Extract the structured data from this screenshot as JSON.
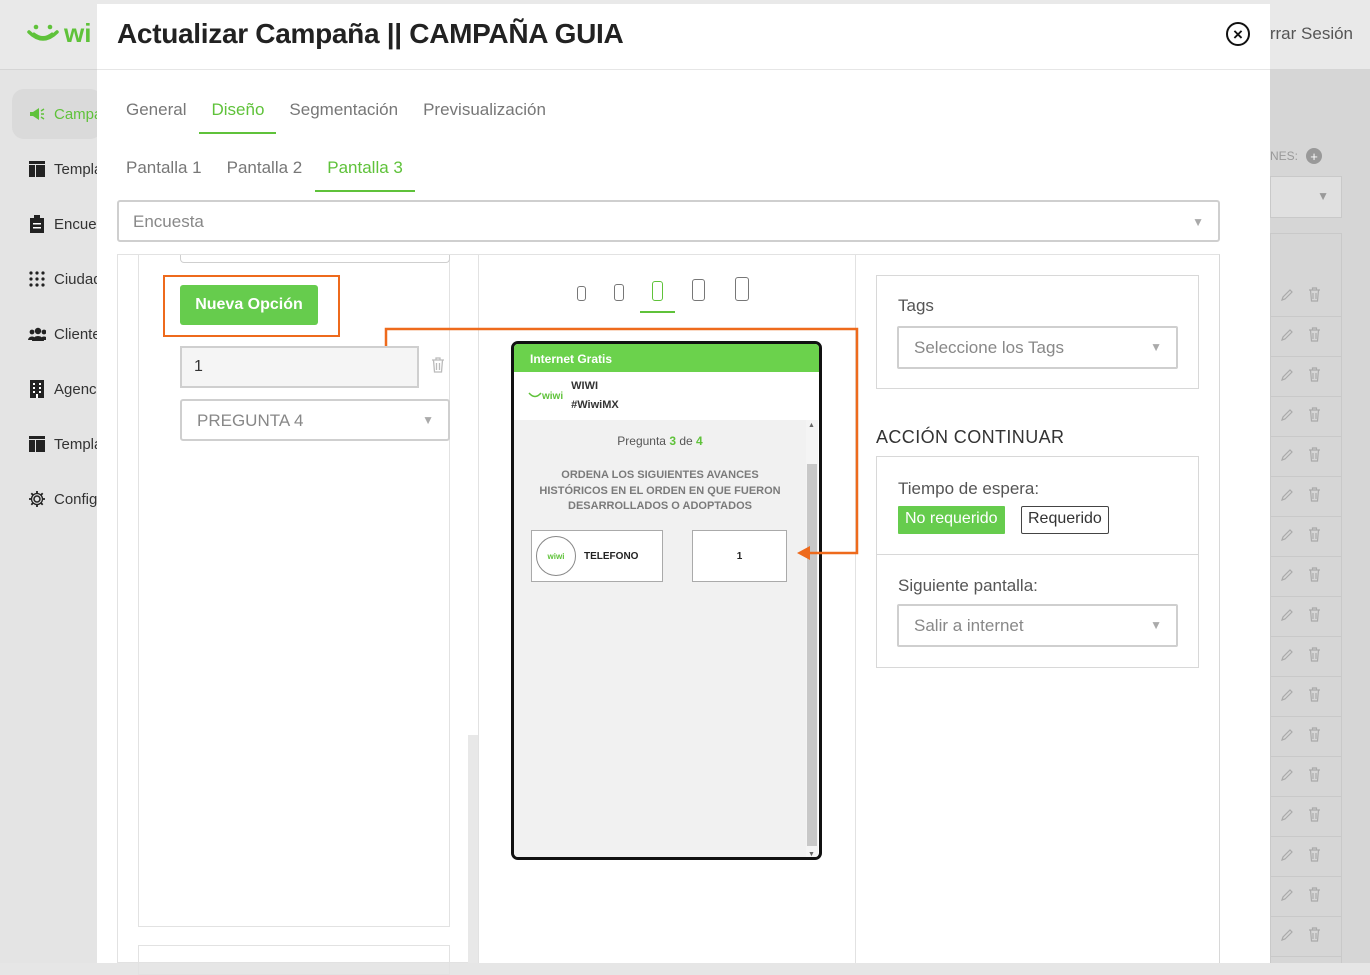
{
  "app": {
    "logo_text": "wi",
    "logout_label": "rrar Sesión"
  },
  "sidebar": {
    "items": [
      {
        "label": "Campa",
        "icon": "megaphone-icon"
      },
      {
        "label": "Templa",
        "icon": "template-icon"
      },
      {
        "label": "Encues",
        "icon": "clipboard-icon"
      },
      {
        "label": "Ciudad",
        "icon": "grid-dots-icon"
      },
      {
        "label": "Cliente",
        "icon": "users-icon"
      },
      {
        "label": "Agenci",
        "icon": "building-icon"
      },
      {
        "label": "Templa",
        "icon": "template-icon"
      },
      {
        "label": "Config",
        "icon": "gear-icon"
      }
    ]
  },
  "background_table": {
    "header_label": "NES:"
  },
  "modal": {
    "title": "Actualizar Campaña || CAMPAÑA GUIA",
    "tabs": [
      "General",
      "Diseño",
      "Segmentación",
      "Previsualización"
    ],
    "active_tab": "Diseño",
    "screens": [
      "Pantalla 1",
      "Pantalla 2",
      "Pantalla 3"
    ],
    "active_screen": "Pantalla 3",
    "survey_select": "Encuesta",
    "new_option_button": "Nueva Opción",
    "option_value": "1",
    "question_select": "PREGUNTA 4"
  },
  "preview": {
    "header": "Internet Gratis",
    "brand_small": "wiwi",
    "brand_name": "WIWI",
    "brand_tag": "#WiwiMX",
    "question_prefix": "Pregunta",
    "question_current": "3",
    "question_of": "de",
    "question_total": "4",
    "question_text": "ORDENA LOS SIGUIENTES AVANCES HISTÓRICOS EN EL ORDEN EN QUE FUERON DESARROLLADOS O ADOPTADOS",
    "card_logo": "wiwi",
    "card_label": "TELEFONO",
    "card_value": "1"
  },
  "right": {
    "tags_label": "Tags",
    "tags_placeholder": "Seleccione los Tags",
    "action_title": "ACCIÓN CONTINUAR",
    "wait_label": "Tiempo de espera:",
    "not_required": "No requerido",
    "required": "Requerido",
    "next_label": "Siguiente pantalla:",
    "next_value": "Salir a internet"
  },
  "colors": {
    "accent": "#5fc23a",
    "highlight": "#ee6a1c"
  }
}
